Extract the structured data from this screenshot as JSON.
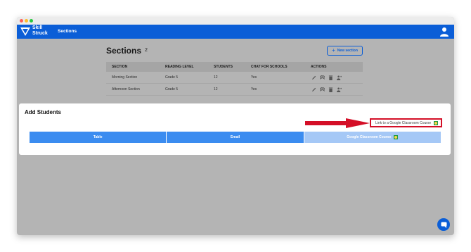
{
  "app": {
    "logo_line1": "Skill",
    "logo_line2": "Struck",
    "nav_label": "Sections"
  },
  "page": {
    "title": "Sections",
    "count": "2",
    "new_section_label": "New section"
  },
  "table": {
    "headers": [
      "SECTION",
      "READING LEVEL",
      "STUDENTS",
      "CHAT FOR SCHOOLS",
      "ACTIONS"
    ],
    "rows": [
      [
        "Morning Section",
        "Grade 5",
        "12",
        "Yes"
      ],
      [
        "Afternoon Section",
        "Grade 5",
        "12",
        "Yes"
      ]
    ],
    "action_icons": [
      "pencil-icon",
      "invite-icon",
      "trash-icon",
      "add-user-icon"
    ]
  },
  "modal": {
    "title": "Add Students",
    "google_link_label": "Link to a Google Classroom Course",
    "tabs": [
      "Table",
      "Email",
      "Google Classroom Course"
    ],
    "active_tab": "Google Classroom Course"
  },
  "colors": {
    "brand_blue": "#0b5ed7",
    "tab_blue": "#3b8cf0",
    "tab_light": "#a5c8f6",
    "highlight_red": "#d40f27",
    "google_green": "#1f9d45"
  }
}
